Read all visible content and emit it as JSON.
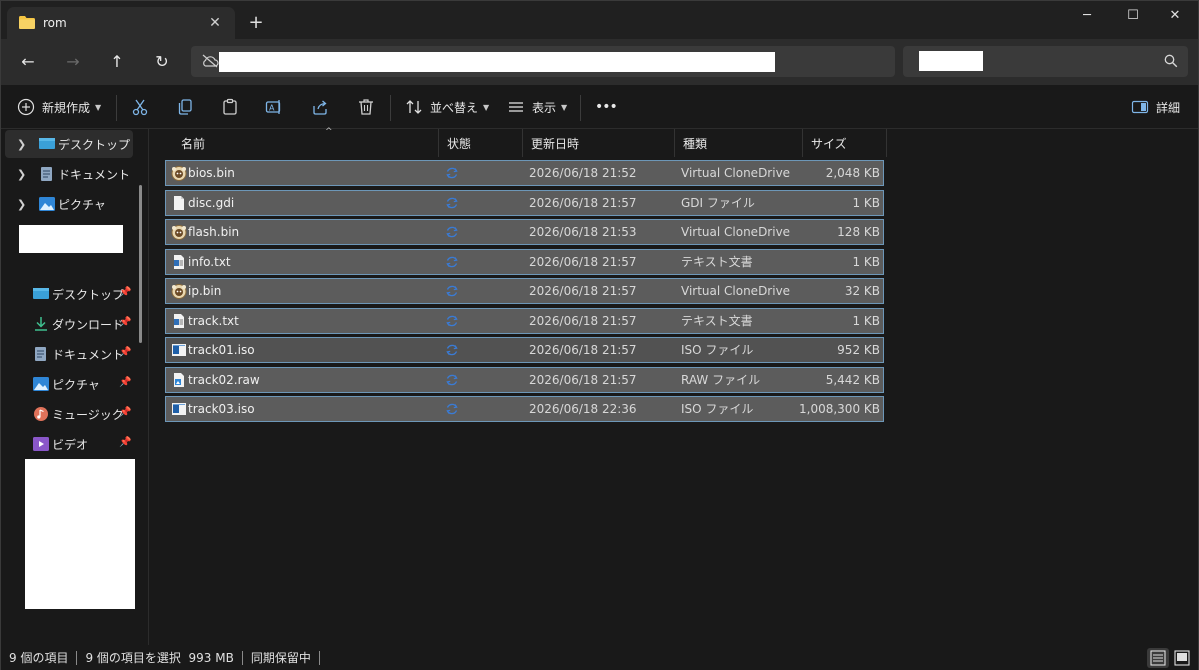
{
  "window": {
    "tab_title": "rom",
    "close_tab": "✕",
    "new_tab": "+",
    "minimize": "─",
    "maximize": "☐",
    "close": "✕"
  },
  "nav": {
    "back": "←",
    "forward": "→",
    "up": "↑",
    "refresh": "↻"
  },
  "commands": {
    "new_label": "新規作成",
    "sort_label": "並べ替え",
    "view_label": "表示",
    "more_label": "•••",
    "details_label": "詳細"
  },
  "sidebar": {
    "tree": [
      {
        "label": "デスクトップ",
        "icon": "desktop-folder-icon"
      },
      {
        "label": "ドキュメント",
        "icon": "documents-folder-icon"
      },
      {
        "label": "ピクチャ",
        "icon": "pictures-folder-icon"
      }
    ],
    "quick": [
      {
        "label": "デスクトップ",
        "icon": "desktop-folder-icon"
      },
      {
        "label": "ダウンロード",
        "icon": "download-icon"
      },
      {
        "label": "ドキュメント",
        "icon": "documents-folder-icon"
      },
      {
        "label": "ピクチャ",
        "icon": "pictures-folder-icon"
      },
      {
        "label": "ミュージック",
        "icon": "music-folder-icon"
      },
      {
        "label": "ビデオ",
        "icon": "videos-folder-icon"
      }
    ],
    "pin": "📌"
  },
  "columns": {
    "name": "名前",
    "status": "状態",
    "modified": "更新日時",
    "type": "種類",
    "size": "サイズ"
  },
  "files": [
    {
      "name": "bios.bin",
      "date": "2026/06/18 21:52",
      "type": "Virtual CloneDrive",
      "size": "2,048 KB",
      "icon": "clonedrive-sheep-icon"
    },
    {
      "name": "disc.gdi",
      "date": "2026/06/18 21:57",
      "type": "GDI ファイル",
      "size": "1 KB",
      "icon": "blank-file-icon"
    },
    {
      "name": "flash.bin",
      "date": "2026/06/18 21:53",
      "type": "Virtual CloneDrive",
      "size": "128 KB",
      "icon": "clonedrive-sheep-icon"
    },
    {
      "name": "info.txt",
      "date": "2026/06/18 21:57",
      "type": "テキスト文書",
      "size": "1 KB",
      "icon": "text-file-icon"
    },
    {
      "name": "ip.bin",
      "date": "2026/06/18 21:57",
      "type": "Virtual CloneDrive",
      "size": "32 KB",
      "icon": "clonedrive-sheep-icon"
    },
    {
      "name": "track.txt",
      "date": "2026/06/18 21:57",
      "type": "テキスト文書",
      "size": "1 KB",
      "icon": "text-file-icon"
    },
    {
      "name": "track01.iso",
      "date": "2026/06/18 21:57",
      "type": "ISO ファイル",
      "size": "952 KB",
      "icon": "iso-file-icon"
    },
    {
      "name": "track02.raw",
      "date": "2026/06/18 21:57",
      "type": "RAW ファイル",
      "size": "5,442 KB",
      "icon": "raw-file-icon"
    },
    {
      "name": "track03.iso",
      "date": "2026/06/18 22:36",
      "type": "ISO ファイル",
      "size": "1,008,300 KB",
      "icon": "iso-file-icon"
    }
  ],
  "status": {
    "count": "9 個の項目",
    "selected": "9 個の項目を選択  993 MB",
    "sync": "同期保留中"
  },
  "colors": {
    "selection_fill": "#5c5c5c",
    "selection_border": "#6d97b8",
    "sync_blue": "#3a7bd5",
    "folder_yellow": "#f4c542"
  }
}
